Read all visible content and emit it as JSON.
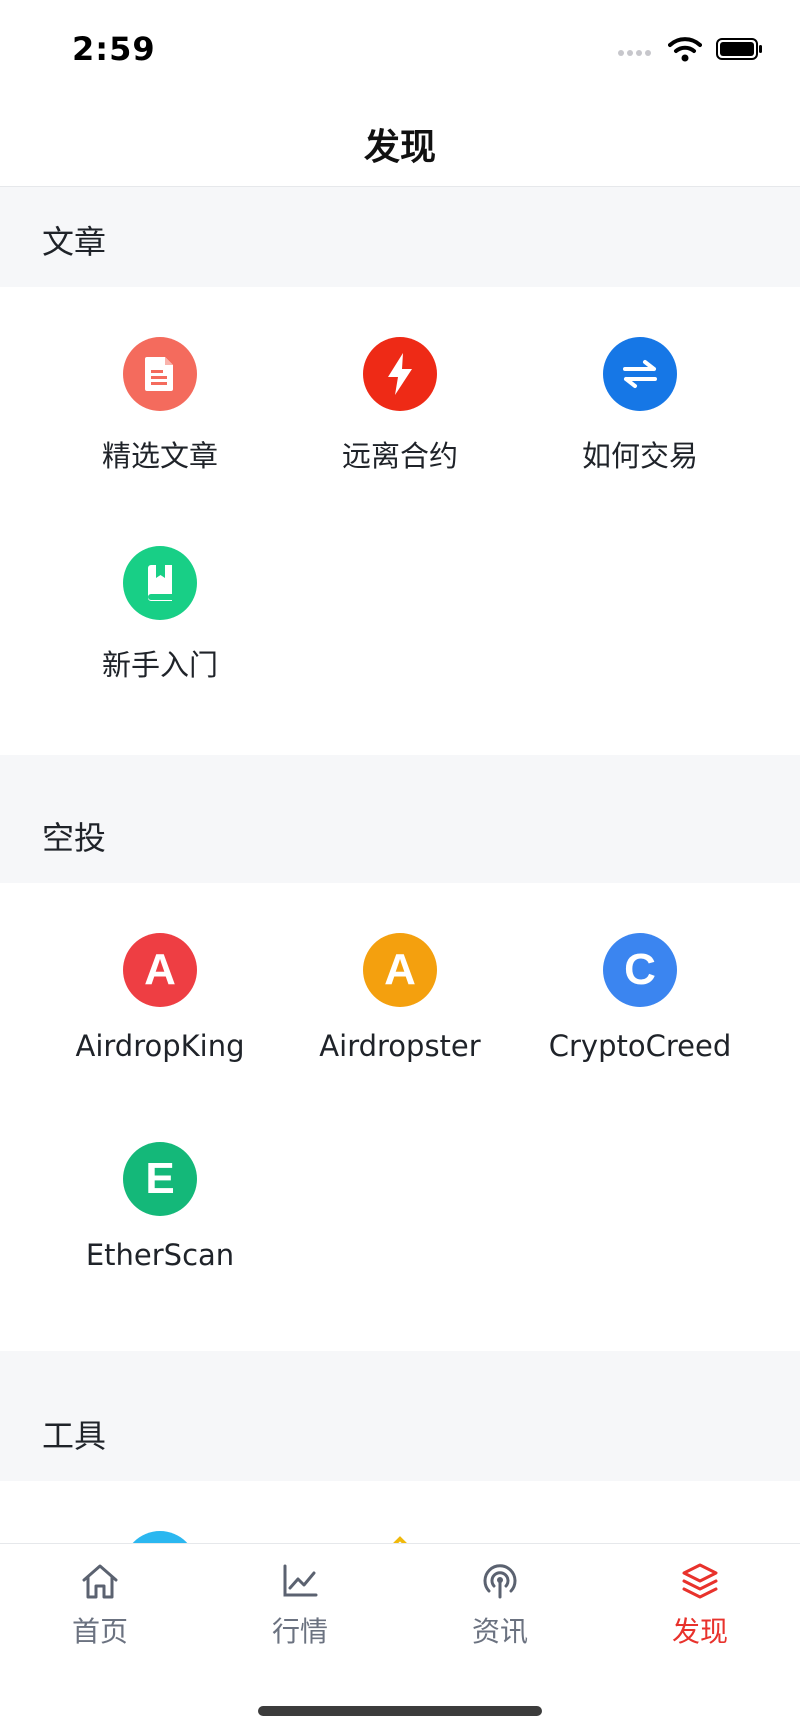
{
  "status": {
    "time": "2:59"
  },
  "nav": {
    "title": "发现"
  },
  "sections": [
    {
      "title": "文章",
      "items": [
        {
          "label": "精选文章",
          "icon": "document-icon",
          "color": "#f46b5d"
        },
        {
          "label": "远离合约",
          "icon": "lightning-icon",
          "color": "#ee2a16"
        },
        {
          "label": "如何交易",
          "icon": "exchange-arrows-icon",
          "color": "#1677e6"
        },
        {
          "label": "新手入门",
          "icon": "book-icon",
          "color": "#18cf86"
        }
      ]
    },
    {
      "title": "空投",
      "items": [
        {
          "label": "AirdropKing",
          "letter": "A",
          "color": "#ee3e43"
        },
        {
          "label": "Airdropster",
          "letter": "A",
          "color": "#f4a00e"
        },
        {
          "label": "CryptoCreed",
          "letter": "C",
          "color": "#3b85f0"
        },
        {
          "label": "EtherScan",
          "letter": "E",
          "color": "#14b879"
        }
      ]
    },
    {
      "title": "工具",
      "items": [
        {
          "label": "",
          "icon": "browser-e-icon",
          "color": "#2bb7f0"
        },
        {
          "label": "",
          "icon": "binance-logo-icon",
          "color": "#f0b90b"
        },
        {
          "label": "",
          "icon": "wave-logo-icon",
          "color": "#1681c4"
        }
      ]
    }
  ],
  "tabbar": {
    "items": [
      {
        "label": "首页",
        "icon": "home-icon"
      },
      {
        "label": "行情",
        "icon": "chart-line-icon"
      },
      {
        "label": "资讯",
        "icon": "broadcast-icon"
      },
      {
        "label": "发现",
        "icon": "layers-icon"
      }
    ],
    "active_color": "#e8322c"
  }
}
